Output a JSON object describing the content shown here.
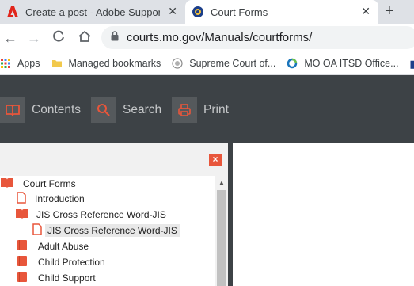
{
  "browser": {
    "tabs": [
      {
        "title": "Create a post - Adobe Support C",
        "icon": "adobe-icon",
        "active": false
      },
      {
        "title": "Court Forms",
        "icon": "mo-seal-icon",
        "active": true
      }
    ],
    "address": "courts.mo.gov/Manuals/courtforms/",
    "bookmarks": [
      {
        "label": "Apps",
        "icon": "apps-grid-icon"
      },
      {
        "label": "Managed bookmarks",
        "icon": "folder-icon"
      },
      {
        "label": "Supreme Court of...",
        "icon": "court-seal-icon"
      },
      {
        "label": "MO OA ITSD Office...",
        "icon": "office-ring-icon"
      }
    ]
  },
  "toolbar": {
    "contents_label": "Contents",
    "search_label": "Search",
    "print_label": "Print",
    "accent": "#e8563b",
    "background": "#3d4246"
  },
  "pane": {
    "close_glyph": "×"
  },
  "tree": {
    "items": [
      {
        "label": "Court Forms",
        "icon": "book-open-icon"
      },
      {
        "label": "Introduction",
        "icon": "page-icon"
      },
      {
        "label": "JIS Cross Reference Word-JIS",
        "icon": "book-open-icon"
      },
      {
        "label": "JIS Cross Reference Word-JIS",
        "icon": "page-icon",
        "selected": true
      },
      {
        "label": "Adult Abuse",
        "icon": "book-closed-icon"
      },
      {
        "label": "Child Protection",
        "icon": "book-closed-icon"
      },
      {
        "label": "Child Support",
        "icon": "book-closed-icon"
      }
    ]
  }
}
